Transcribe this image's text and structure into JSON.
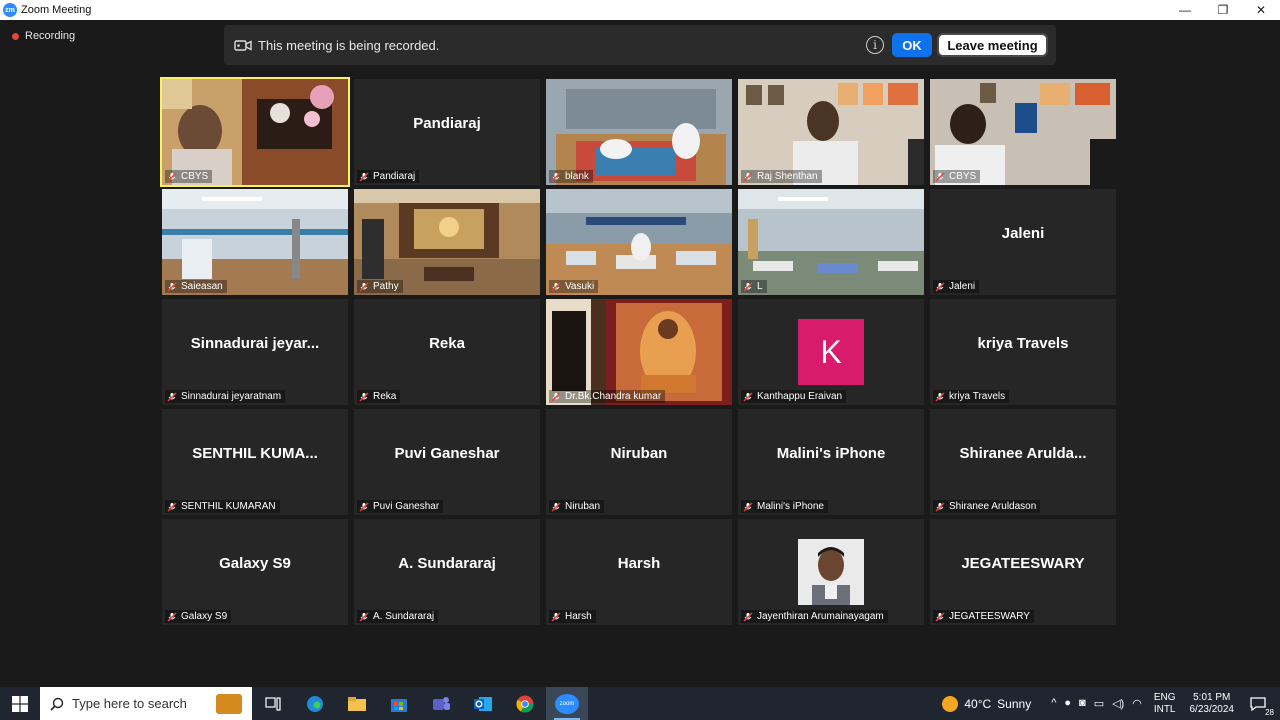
{
  "window": {
    "title": "Zoom Meeting",
    "minimize": "—",
    "restore": "❐",
    "close": "✕"
  },
  "recording": {
    "indicator": "Recording",
    "banner_text": "This meeting is being recorded.",
    "info_glyph": "i",
    "ok_label": "OK",
    "leave_label": "Leave meeting"
  },
  "participants": [
    {
      "name": "CBYS",
      "display": "",
      "kind": "video",
      "scene": "office-plants",
      "active": true
    },
    {
      "name": "Pandiaraj",
      "display": "Pandiaraj",
      "kind": "name"
    },
    {
      "name": "blank",
      "display": "",
      "kind": "video",
      "scene": "room-yoga"
    },
    {
      "name": "Raj Shenthan",
      "display": "",
      "kind": "video",
      "scene": "office-man"
    },
    {
      "name": "CBYS",
      "display": "",
      "kind": "video",
      "scene": "office-man-dark"
    },
    {
      "name": "Saieasan",
      "display": "",
      "kind": "video",
      "scene": "gym"
    },
    {
      "name": "Pathy",
      "display": "",
      "kind": "video",
      "scene": "shrine"
    },
    {
      "name": "Vasuki",
      "display": "",
      "kind": "video",
      "scene": "hall-yoga"
    },
    {
      "name": "L",
      "display": "",
      "kind": "video",
      "scene": "hall-yoga-2"
    },
    {
      "name": "Jaleni",
      "display": "Jaleni",
      "kind": "name"
    },
    {
      "name": "Sinnadurai jeyaratnam",
      "display": "Sinnadurai  jeyar...",
      "kind": "name"
    },
    {
      "name": "Reka",
      "display": "Reka",
      "kind": "name"
    },
    {
      "name": "Dr.Bk.Chandra kumar",
      "display": "",
      "kind": "video",
      "scene": "portrait"
    },
    {
      "name": "Kanthappu Eraivan",
      "display": "",
      "kind": "avatar",
      "letter": "K",
      "color": "#d81b6a"
    },
    {
      "name": "kriya Travels",
      "display": "kriya Travels",
      "kind": "name"
    },
    {
      "name": "SENTHIL KUMARAN",
      "display": "SENTHIL  KUMA...",
      "kind": "name"
    },
    {
      "name": "Puvi Ganeshar",
      "display": "Puvi Ganeshar",
      "kind": "name"
    },
    {
      "name": "Niruban",
      "display": "Niruban",
      "kind": "name"
    },
    {
      "name": "Malini's iPhone",
      "display": "Malini's iPhone",
      "kind": "name"
    },
    {
      "name": "Shiranee Aruldason",
      "display": "Shiranee  Arulda...",
      "kind": "name"
    },
    {
      "name": "Galaxy S9",
      "display": "Galaxy S9",
      "kind": "name"
    },
    {
      "name": "A. Sundararaj",
      "display": "A. Sundararaj",
      "kind": "name"
    },
    {
      "name": "Harsh",
      "display": "Harsh",
      "kind": "name"
    },
    {
      "name": "Jayenthiran Arumainayagam",
      "display": "",
      "kind": "photo"
    },
    {
      "name": "JEGATEESWARY",
      "display": "JEGATEESWARY",
      "kind": "name"
    }
  ],
  "taskbar": {
    "search_placeholder": "Type here to search",
    "weather_temp": "40°C",
    "weather_text": "Sunny",
    "lang_line1": "ENG",
    "lang_line2": "INTL",
    "time": "5:01 PM",
    "date": "6/23/2024",
    "notification_count": "28",
    "zoom_app_label": "zoom"
  },
  "colors": {
    "accent": "#0e72ed",
    "active_speaker": "#f7f163",
    "muted_mic": "#e8453c"
  }
}
